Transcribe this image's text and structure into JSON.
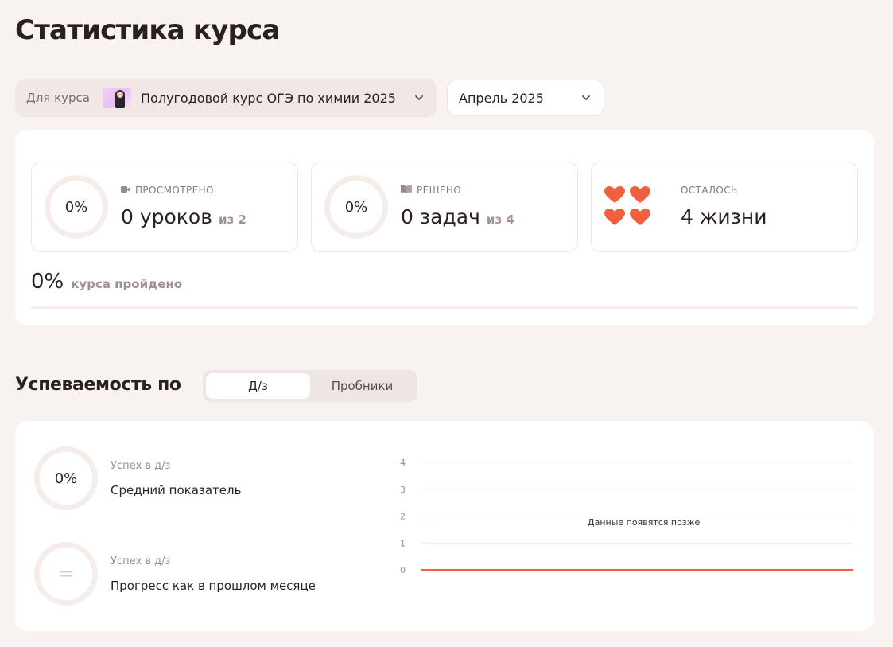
{
  "page": {
    "title": "Статистика курса"
  },
  "filters": {
    "course_label": "Для курса",
    "course_value": "Полугодовой курс ОГЭ по химии 2025",
    "month_value": "Апрель 2025"
  },
  "stats": {
    "viewed": {
      "percent": "0%",
      "label": "ПРОСМОТРЕНО",
      "value": "0 уроков",
      "total": "из 2",
      "icon": "video-icon"
    },
    "solved": {
      "percent": "0%",
      "label": "РЕШЕНО",
      "value": "0 задач",
      "total": "из 4",
      "icon": "book-icon"
    },
    "lives": {
      "label": "ОСТАЛОСЬ",
      "value": "4 жизни",
      "hearts": 4,
      "icon": "heart-icon",
      "heart_color": "#f0603f"
    }
  },
  "course_progress": {
    "percent": "0%",
    "label": "курса пройдено",
    "fraction": 0
  },
  "performance": {
    "title": "Успеваемость по",
    "tabs": [
      {
        "label": "Д/з",
        "active": true
      },
      {
        "label": "Пробники",
        "active": false
      }
    ],
    "metrics": [
      {
        "value": "0%",
        "sub": "Успех в д/з",
        "label": "Средний показатель"
      },
      {
        "value": "=",
        "sub": "Успех в д/з",
        "label": "Прогресс как в прошлом месяце"
      }
    ]
  },
  "chart_data": {
    "type": "line",
    "y_ticks": [
      "4",
      "3",
      "2",
      "1",
      "0"
    ],
    "ylim": [
      0,
      4
    ],
    "empty_message": "Данные появятся позже",
    "line_color": "#f0603f",
    "series": [
      {
        "values": [
          0,
          0
        ]
      }
    ]
  },
  "colors": {
    "accent": "#f0603f",
    "background": "#f8f3f1"
  }
}
